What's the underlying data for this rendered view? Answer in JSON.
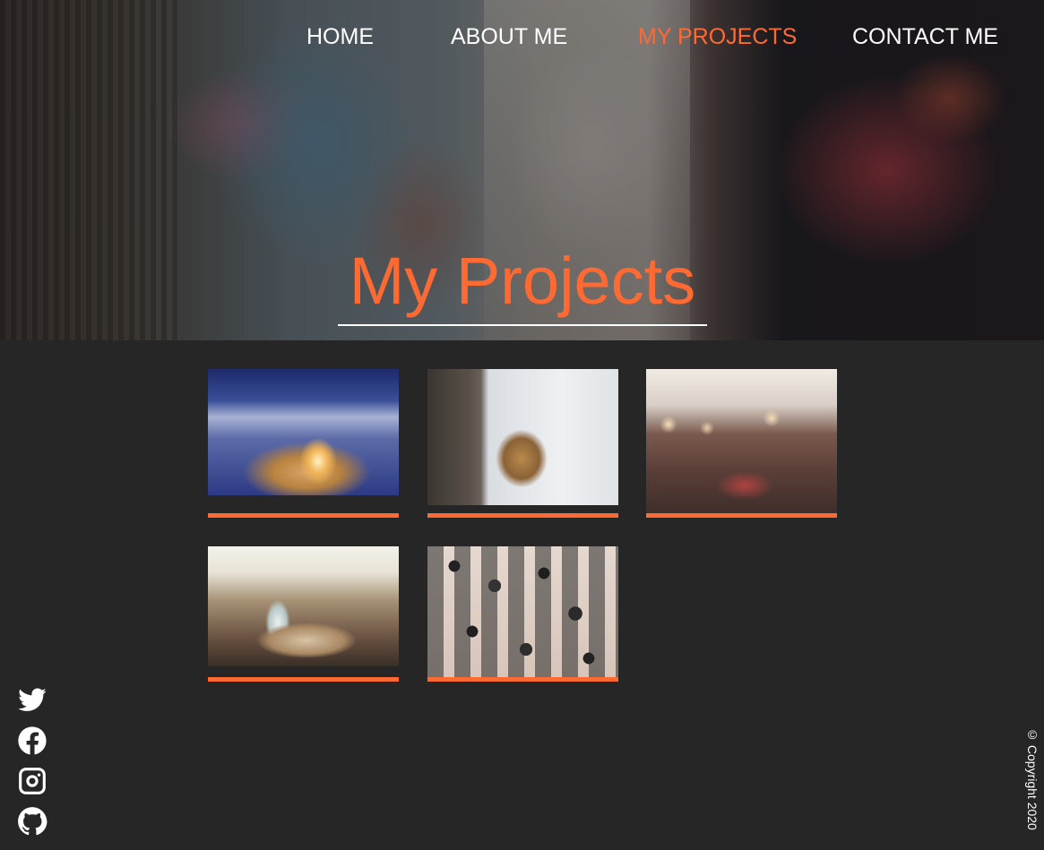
{
  "nav": {
    "items": [
      {
        "label": "HOME",
        "active": false
      },
      {
        "label": "ABOUT ME",
        "active": false
      },
      {
        "label": "MY PROJECTS",
        "active": true
      },
      {
        "label": "CONTACT ME",
        "active": false
      }
    ]
  },
  "hero": {
    "title": "My Projects"
  },
  "projects": [
    {
      "image": "igloo-at-night"
    },
    {
      "image": "lion-at-window"
    },
    {
      "image": "city-street-with-bokeh"
    },
    {
      "image": "car-interior-with-glasses"
    },
    {
      "image": "camera-collection"
    }
  ],
  "social": [
    {
      "icon": "twitter-icon"
    },
    {
      "icon": "facebook-icon"
    },
    {
      "icon": "instagram-icon"
    },
    {
      "icon": "github-icon"
    }
  ],
  "footer": {
    "copyright": "© Copyright 2020"
  },
  "colors": {
    "accent": "#ff6a33",
    "background": "#262626",
    "text": "#ffffff"
  }
}
